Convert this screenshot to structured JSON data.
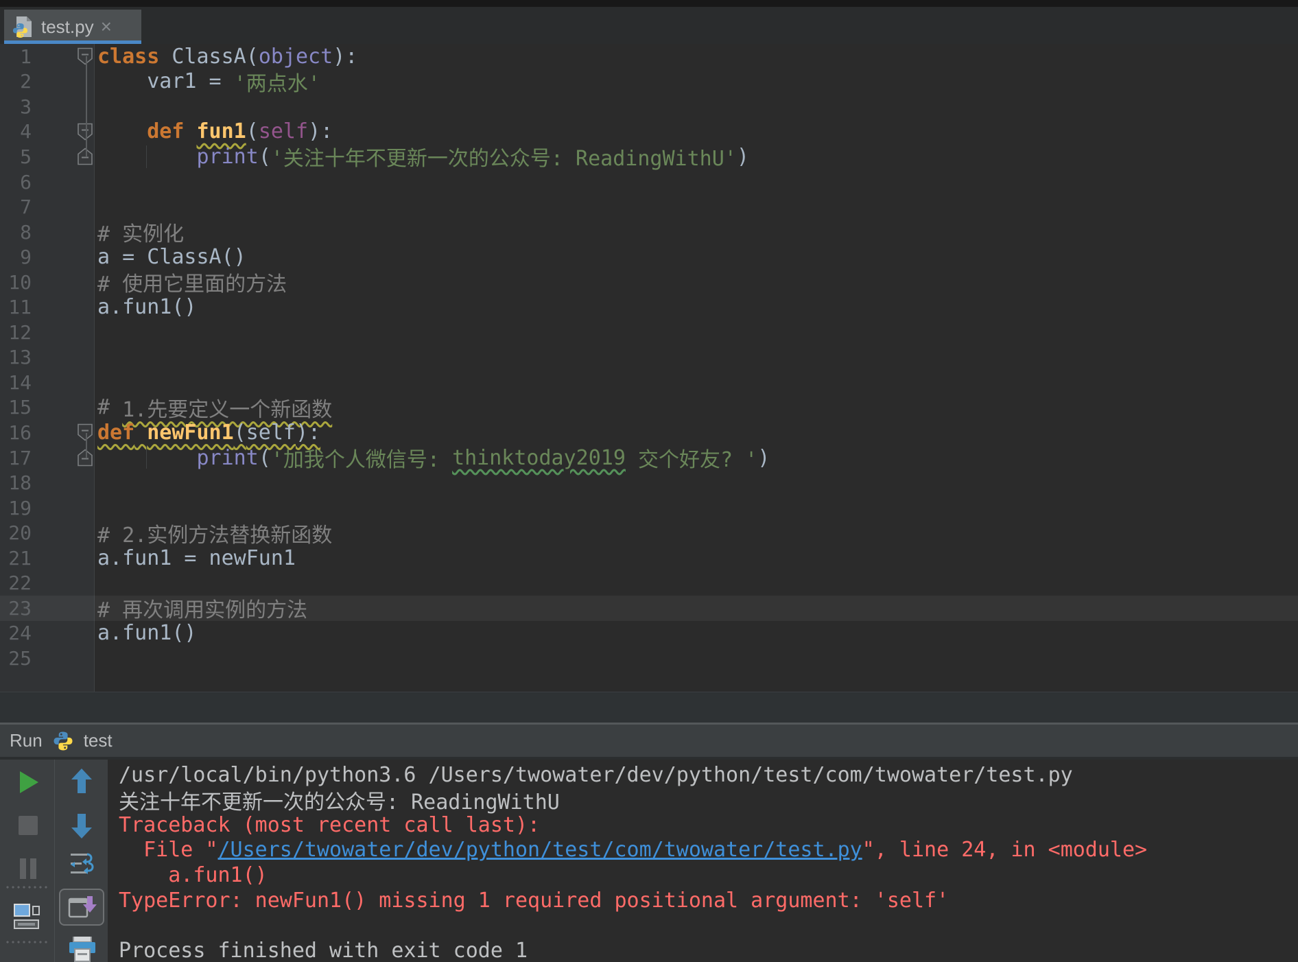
{
  "tab": {
    "title": "test.py",
    "close_glyph": "×"
  },
  "run_header": {
    "label": "Run",
    "target": "test"
  },
  "accent_colors": {
    "tab_underline": "#4A88C7",
    "error": "#FF6B68",
    "hyperlink": "#3F90DA",
    "keyword": "#CC7832",
    "string": "#6A8759",
    "comment": "#808080",
    "function": "#FFC66D",
    "builtin": "#8888C6",
    "run_green": "#3FA142"
  },
  "editor": {
    "line_count": 25,
    "current_line": 23,
    "fold_markers": [
      {
        "line": 1,
        "dir": "down"
      },
      {
        "line": 4,
        "dir": "down"
      },
      {
        "line": 5,
        "dir": "up"
      },
      {
        "line": 16,
        "dir": "down"
      },
      {
        "line": 17,
        "dir": "up"
      }
    ],
    "fold_ranges": [
      [
        1,
        5
      ],
      [
        16,
        17
      ]
    ],
    "indent_guides": [
      5,
      17
    ],
    "lines": [
      {
        "n": 1,
        "tokens": [
          [
            "kw",
            "class"
          ],
          [
            "plain",
            " ClassA("
          ],
          [
            "builtin",
            "object"
          ],
          [
            "plain",
            "):"
          ]
        ]
      },
      {
        "n": 2,
        "tokens": [
          [
            "plain",
            "    var1 = "
          ],
          [
            "str",
            "'两点水'"
          ]
        ]
      },
      {
        "n": 3,
        "tokens": []
      },
      {
        "n": 4,
        "tokens": [
          [
            "plain",
            "    "
          ],
          [
            "kw",
            "def"
          ],
          [
            "plain",
            " "
          ],
          [
            "fn wavy-y",
            "fun1"
          ],
          [
            "plain",
            "("
          ],
          [
            "self",
            "self"
          ],
          [
            "plain",
            "):"
          ]
        ]
      },
      {
        "n": 5,
        "tokens": [
          [
            "plain",
            "        "
          ],
          [
            "builtin",
            "print"
          ],
          [
            "plain",
            "("
          ],
          [
            "str",
            "'关注十年不更新一次的公众号: ReadingWithU'"
          ],
          [
            "plain",
            ")"
          ]
        ]
      },
      {
        "n": 6,
        "tokens": []
      },
      {
        "n": 7,
        "tokens": []
      },
      {
        "n": 8,
        "tokens": [
          [
            "comment",
            "# 实例化"
          ]
        ]
      },
      {
        "n": 9,
        "tokens": [
          [
            "plain",
            "a = ClassA()"
          ]
        ]
      },
      {
        "n": 10,
        "tokens": [
          [
            "comment",
            "# 使用它里面的方法"
          ]
        ]
      },
      {
        "n": 11,
        "tokens": [
          [
            "plain",
            "a.fun1()"
          ]
        ]
      },
      {
        "n": 12,
        "tokens": []
      },
      {
        "n": 13,
        "tokens": []
      },
      {
        "n": 14,
        "tokens": []
      },
      {
        "n": 15,
        "tokens": [
          [
            "comment",
            "# "
          ],
          [
            "comment wavy-y",
            "1.先要定义一个新函数"
          ]
        ]
      },
      {
        "n": 16,
        "tokens": [
          [
            "kw wavy-y",
            "def"
          ],
          [
            "plain wavy-y",
            " "
          ],
          [
            "fn wavy-y",
            "newFun1"
          ],
          [
            "plain wavy-y",
            "("
          ],
          [
            "plain wavy-y",
            "self"
          ],
          [
            "plain wavy-y",
            "):"
          ]
        ]
      },
      {
        "n": 17,
        "tokens": [
          [
            "plain",
            "        "
          ],
          [
            "builtin",
            "print"
          ],
          [
            "plain",
            "("
          ],
          [
            "str",
            "'加我个人微信号: "
          ],
          [
            "str wavy-g",
            "thinktoday2019"
          ],
          [
            "str",
            " 交个好友? '"
          ],
          [
            "plain",
            ")"
          ]
        ]
      },
      {
        "n": 18,
        "tokens": []
      },
      {
        "n": 19,
        "tokens": []
      },
      {
        "n": 20,
        "tokens": [
          [
            "comment",
            "# 2.实例方法替换新函数"
          ]
        ]
      },
      {
        "n": 21,
        "tokens": [
          [
            "plain",
            "a.fun1 = newFun1"
          ]
        ]
      },
      {
        "n": 22,
        "tokens": []
      },
      {
        "n": 23,
        "tokens": [
          [
            "comment",
            "# 再次调用实例的方法"
          ]
        ]
      },
      {
        "n": 24,
        "tokens": [
          [
            "plain",
            "a.fun1()"
          ]
        ]
      },
      {
        "n": 25,
        "tokens": []
      }
    ]
  },
  "console": {
    "rows": [
      {
        "parts": [
          [
            "out",
            "/usr/local/bin/python3.6 /Users/twowater/dev/python/test/com/twowater/test.py"
          ]
        ]
      },
      {
        "parts": [
          [
            "out",
            "关注十年不更新一次的公众号: ReadingWithU"
          ]
        ]
      },
      {
        "parts": [
          [
            "err",
            "Traceback (most recent call last):"
          ]
        ]
      },
      {
        "parts": [
          [
            "err",
            "  File \""
          ],
          [
            "link",
            "/Users/twowater/dev/python/test/com/twowater/test.py"
          ],
          [
            "err",
            "\", line 24, in <module>"
          ]
        ]
      },
      {
        "parts": [
          [
            "err",
            "    a.fun1()"
          ]
        ]
      },
      {
        "parts": [
          [
            "err",
            "TypeError: newFun1() missing 1 required positional argument: 'self'"
          ]
        ]
      },
      {
        "parts": []
      },
      {
        "parts": [
          [
            "out",
            "Process finished with exit code 1"
          ]
        ]
      }
    ]
  },
  "toolbar": {
    "left_icons": [
      "rerun",
      "stop",
      "pause",
      "console-settings"
    ],
    "right_icons": [
      "up-the-stack-trace",
      "down-the-stack-trace",
      "soft-wrap",
      "scroll-to-end",
      "print"
    ]
  }
}
